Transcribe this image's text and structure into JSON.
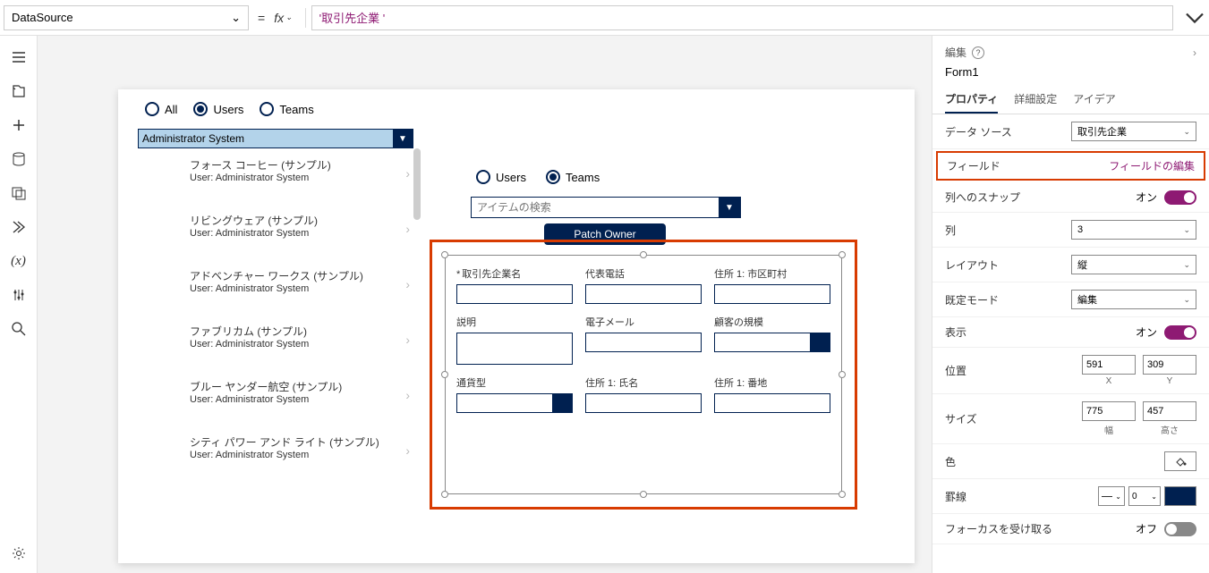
{
  "formula_bar": {
    "property": "DataSource",
    "equals": "=",
    "fx": "fx",
    "value": "'取引先企業 '"
  },
  "canvas": {
    "radio1": {
      "all": "All",
      "users": "Users",
      "teams": "Teams"
    },
    "radio2": {
      "users": "Users",
      "teams": "Teams"
    },
    "combo_value": "Administrator System",
    "gallery": [
      {
        "title": "フォース コーヒー (サンプル)",
        "sub": "User: Administrator System"
      },
      {
        "title": "リビングウェア (サンプル)",
        "sub": "User: Administrator System"
      },
      {
        "title": "アドベンチャー ワークス (サンプル)",
        "sub": "User: Administrator System"
      },
      {
        "title": "ファブリカム (サンプル)",
        "sub": "User: Administrator System"
      },
      {
        "title": "ブルー ヤンダー航空 (サンプル)",
        "sub": "User: Administrator System"
      },
      {
        "title": "シティ パワー アンド ライト (サンプル)",
        "sub": "User: Administrator System"
      }
    ],
    "search_placeholder": "アイテムの検索",
    "patch_button": "Patch Owner",
    "form_fields": [
      {
        "label": "取引先企業名",
        "required": true,
        "type": "text"
      },
      {
        "label": "代表電話",
        "required": false,
        "type": "text"
      },
      {
        "label": "住所 1: 市区町村",
        "required": false,
        "type": "text"
      },
      {
        "label": "説明",
        "required": false,
        "type": "textarea"
      },
      {
        "label": "電子メール",
        "required": false,
        "type": "text"
      },
      {
        "label": "顧客の規模",
        "required": false,
        "type": "dropdown"
      },
      {
        "label": "通貨型",
        "required": false,
        "type": "dropdown"
      },
      {
        "label": "住所 1: 氏名",
        "required": false,
        "type": "text"
      },
      {
        "label": "住所 1: 番地",
        "required": false,
        "type": "text"
      }
    ]
  },
  "props": {
    "header_label": "編集",
    "name": "Form1",
    "tabs": {
      "properties": "プロパティ",
      "advanced": "詳細設定",
      "ideas": "アイデア"
    },
    "datasource": {
      "label": "データ ソース",
      "value": "取引先企業"
    },
    "fields": {
      "label": "フィールド",
      "action": "フィールドの編集"
    },
    "snap": {
      "label": "列へのスナップ",
      "value": "オン"
    },
    "columns": {
      "label": "列",
      "value": "3"
    },
    "layout": {
      "label": "レイアウト",
      "value": "縦"
    },
    "default_mode": {
      "label": "既定モード",
      "value": "編集"
    },
    "visible": {
      "label": "表示",
      "value": "オン"
    },
    "position": {
      "label": "位置",
      "x": "591",
      "y": "309",
      "xcap": "X",
      "ycap": "Y"
    },
    "size": {
      "label": "サイズ",
      "w": "775",
      "h": "457",
      "wcap": "幅",
      "hcap": "高さ"
    },
    "color": {
      "label": "色"
    },
    "border": {
      "label": "罫線",
      "width": "0",
      "color": "#002050"
    },
    "focus": {
      "label": "フォーカスを受け取る",
      "value": "オフ"
    }
  }
}
